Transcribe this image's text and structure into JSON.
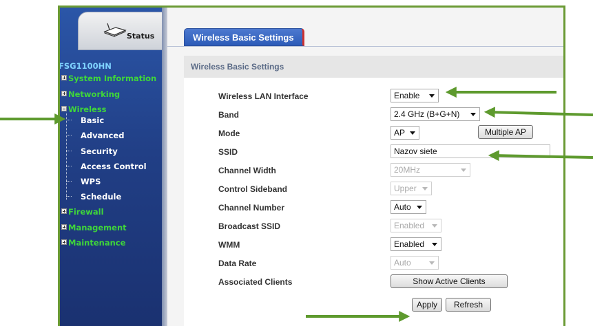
{
  "sidebar": {
    "status_label": "Status",
    "model": "FSG1100HN",
    "items": [
      {
        "label": "System Information",
        "expander": "plus"
      },
      {
        "label": "Networking",
        "expander": "plus"
      },
      {
        "label": "Wireless",
        "expander": "minus"
      },
      {
        "label": "Firewall",
        "expander": "plus"
      },
      {
        "label": "Management",
        "expander": "plus"
      },
      {
        "label": "Maintenance",
        "expander": "plus"
      }
    ],
    "wireless_sub": [
      "Basic",
      "Advanced",
      "Security",
      "Access Control",
      "WPS",
      "Schedule"
    ]
  },
  "tab": {
    "title": "Wireless Basic Settings"
  },
  "section": {
    "title": "Wireless Basic Settings"
  },
  "form": {
    "wlan_interface": {
      "label": "Wireless LAN Interface",
      "value": "Enable"
    },
    "band": {
      "label": "Band",
      "value": "2.4 GHz (B+G+N)"
    },
    "mode": {
      "label": "Mode",
      "value": "AP",
      "button": "Multiple AP"
    },
    "ssid": {
      "label": "SSID",
      "value": "Nazov siete"
    },
    "channel_width": {
      "label": "Channel Width",
      "value": "20MHz"
    },
    "control_sideband": {
      "label": "Control Sideband",
      "value": "Upper"
    },
    "channel_number": {
      "label": "Channel Number",
      "value": "Auto"
    },
    "broadcast_ssid": {
      "label": "Broadcast SSID",
      "value": "Enabled"
    },
    "wmm": {
      "label": "WMM",
      "value": "Enabled"
    },
    "data_rate": {
      "label": "Data Rate",
      "value": "Auto"
    },
    "associated_clients": {
      "label": "Associated Clients",
      "button": "Show Active Clients"
    }
  },
  "actions": {
    "apply": "Apply",
    "refresh": "Refresh"
  },
  "colors": {
    "annotation_arrow": "#5e9a2e",
    "nav_top": "#3fd63a",
    "nav_model": "#7fd3ff",
    "tab_blue": "#2c5bb8"
  }
}
